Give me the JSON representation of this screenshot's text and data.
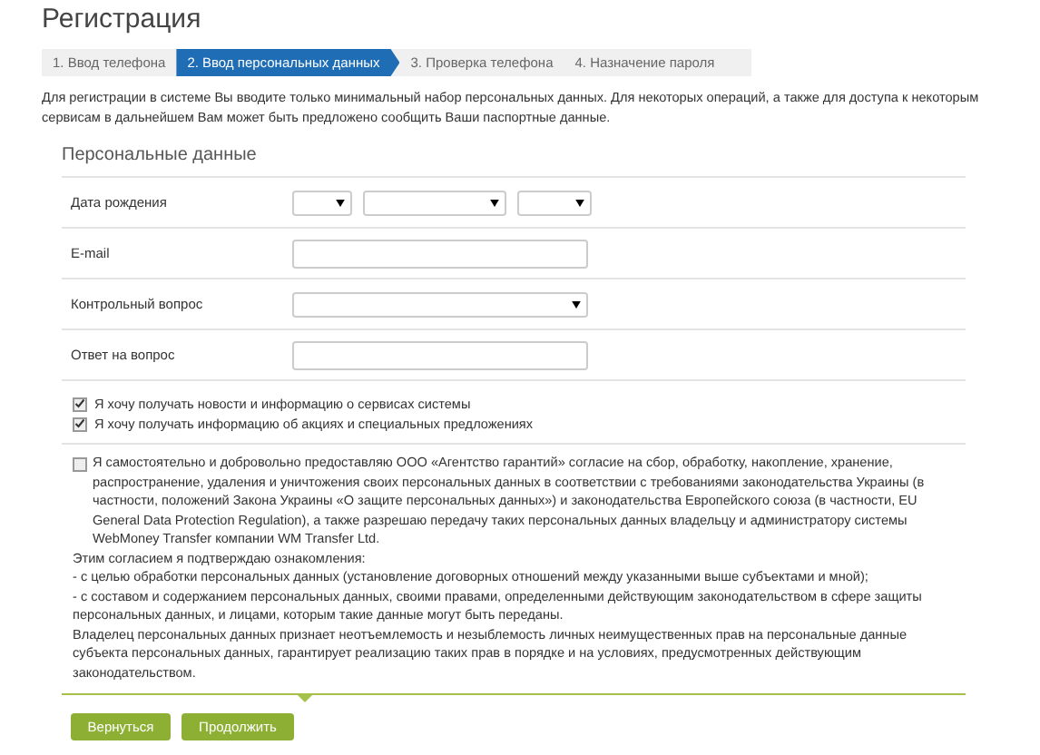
{
  "title": "Регистрация",
  "steps": [
    {
      "label": "1. Ввод телефона",
      "selected": false
    },
    {
      "label": "2. Ввод персональных данных",
      "selected": true
    },
    {
      "label": "3. Проверка телефона",
      "selected": false
    },
    {
      "label": "4. Назначение пароля",
      "selected": false
    }
  ],
  "intro": "Для регистрации в системе Вы вводите только минимальный набор персональных данных. Для некоторых операций, а также для доступа к некоторым сервисам в дальнейшем Вам может быть предложено сообщить Ваши паспортные данные.",
  "section_title": "Персональные данные",
  "fields": [
    {
      "label": "Дата рождения",
      "kind": "date"
    },
    {
      "label": "E-mail",
      "kind": "text"
    },
    {
      "label": "Контрольный вопрос",
      "kind": "select"
    },
    {
      "label": "Ответ на вопрос",
      "kind": "text"
    }
  ],
  "subscriptions": [
    {
      "label": "Я хочу получать новости и информацию о сервисах системы",
      "checked": true
    },
    {
      "label": "Я хочу получать информацию об акциях и специальных предложениях",
      "checked": true
    }
  ],
  "consent": {
    "checked": false,
    "paragraphs": [
      "Я самостоятельно и добровольно предоставляю ООО «Агентство гарантий» согласие на сбор, обработку, накопление, хранение, распространение, удаления и уничтожения своих персональных данных в соответствии с требованиями законодательства Украины (в частности, положений Закона Украины «О защите персональных данных») и законодательства Европейского союза (в частности, EU General Data Protection Regulation), а также разрешаю передачу таких персональных данных владельцу и администратору системы WebMoney Transfer компании WM Transfer Ltd.",
      "Этим согласием я подтверждаю ознакомления:",
      "- с целью обработки персональных данных (установление договорных отношений между указанными выше субъектами и мной);",
      "- с составом и содержанием персональных данных, своими правами, определенными действующим законодательством в сфере защиты персональных данных, и лицами, которым такие данные могут быть переданы.",
      "Владелец персональных данных признает неотъемлемость и незыблемость личных неимущественных прав на персональные данные субъекта персональных данных, гарантирует реализацию таких прав в порядке и на условиях, предусмотренных действующим законодательством."
    ]
  },
  "buttons": [
    "Вернуться",
    "Продолжить"
  ]
}
